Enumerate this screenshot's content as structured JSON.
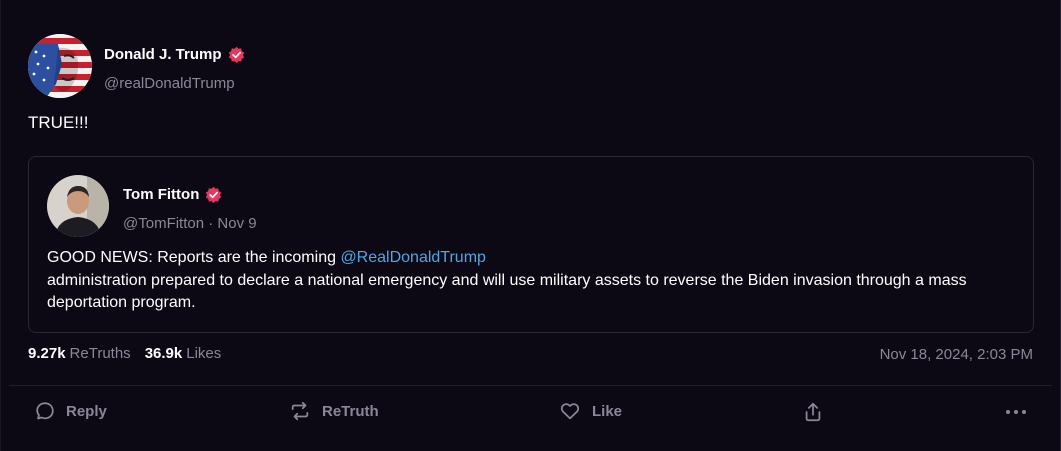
{
  "post": {
    "author_name": "Donald J. Trump",
    "author_handle": "@realDonaldTrump",
    "text": "TRUE!!!"
  },
  "quote": {
    "author_name": "Tom Fitton",
    "author_meta": "@TomFitton · Nov 9",
    "text_prefix": "GOOD NEWS: Reports are the incoming ",
    "mention": "@RealDonaldTrump",
    "text_suffix": " administration prepared to declare a national emergency and will use military assets to reverse the Biden invasion through a mass deportation program."
  },
  "stats": {
    "retruths_count": "9.27k",
    "retruths_label": "ReTruths",
    "likes_count": "36.9k",
    "likes_label": "Likes",
    "timestamp": "Nov 18, 2024, 2:03 PM"
  },
  "actions": {
    "reply": "Reply",
    "retruth": "ReTruth",
    "like": "Like"
  },
  "colors": {
    "background": "#0c0915",
    "muted_text": "#8b8798",
    "mention": "#4ea6e8",
    "verified_badge": "#e8375e"
  },
  "icons": [
    "verified-badge-icon",
    "reply-icon",
    "retruth-icon",
    "like-icon",
    "share-icon",
    "more-icon"
  ]
}
